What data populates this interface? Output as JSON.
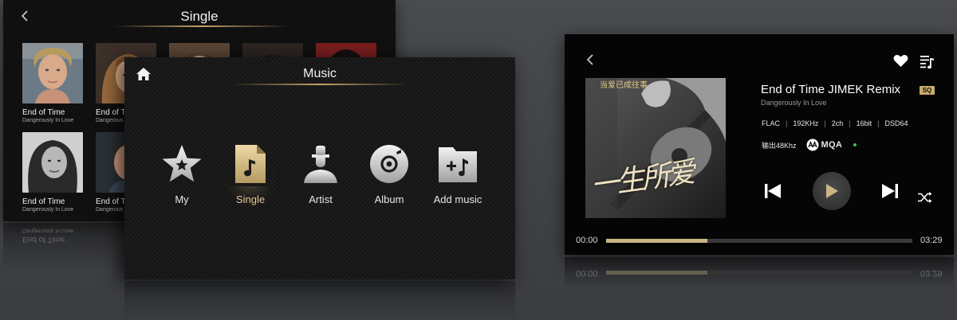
{
  "single_screen": {
    "title": "Single",
    "tracks": [
      {
        "title": "End of Time",
        "artist": "Dangerously In Love"
      },
      {
        "title": "End of Ti",
        "artist": "Dangerous"
      },
      {
        "title": "",
        "artist": ""
      },
      {
        "title": "",
        "artist": ""
      },
      {
        "title": "",
        "artist": ""
      },
      {
        "title": "End of Time",
        "artist": "Dangerously In Love"
      },
      {
        "title": "End of Ti",
        "artist": "Dangerous"
      }
    ],
    "reflection_title": "End of Time",
    "reflection_artist": "Dangerously In Love"
  },
  "music_screen": {
    "title": "Music",
    "menu": [
      {
        "label": "My",
        "icon": "star-icon"
      },
      {
        "label": "Single",
        "icon": "music-note-file-icon"
      },
      {
        "label": "Artist",
        "icon": "person-icon"
      },
      {
        "label": "Album",
        "icon": "disc-icon"
      },
      {
        "label": "Add music",
        "icon": "add-music-folder-icon"
      }
    ],
    "active_index": 1
  },
  "player": {
    "song_title": "End of Time JIMEK Remix",
    "quality_badge": "SQ",
    "artist": "Dangerously In Love",
    "format": [
      "FLAC",
      "192KHz",
      "2ch",
      "16bit",
      "DSD64"
    ],
    "output": "输出48Khz",
    "mqa_label": "MQA",
    "time_elapsed": "00:00",
    "time_total": "03:29",
    "progress_fraction": 0.33,
    "album_text_top": "当爱已成往事",
    "album_calligraphy": "一生所爱"
  },
  "colors": {
    "accent_gold": "#c9b487",
    "active_label": "#e2c790",
    "mqa_dot": "#3dc24e"
  }
}
